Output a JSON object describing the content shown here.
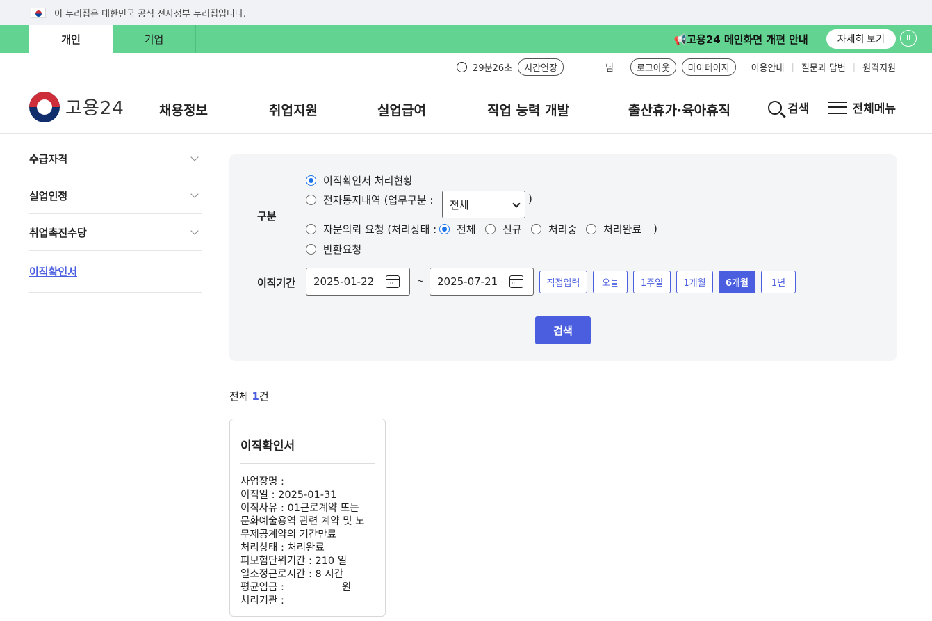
{
  "gov_banner": {
    "text": "이 누리집은 대한민국 공식 전자정부 누리집입니다."
  },
  "top_tabs": {
    "personal": "개인",
    "business": "기업"
  },
  "notice": {
    "text": "📢고용24 메인화면 개편 안내",
    "detail_button": "자세히 보기",
    "pause": "II"
  },
  "util": {
    "timer": "29분26초",
    "extend": "시간연장",
    "user_suffix": "님",
    "logout": "로그아웃",
    "mypage": "마이페이지",
    "links": [
      "이용안내",
      "질문과 답변",
      "원격지원"
    ]
  },
  "logo": {
    "text": "고용24"
  },
  "nav": {
    "items": [
      "채용정보",
      "취업지원",
      "실업급여",
      "직업 능력 개발",
      "출산휴가·육아휴직"
    ],
    "search": "검색",
    "all_menu": "전체메뉴"
  },
  "sidebar": {
    "items": [
      "수급자격",
      "실업인정",
      "취업촉진수당"
    ],
    "active": "이직확인서"
  },
  "form": {
    "category_label": "구분",
    "options": {
      "opt1": "이직확인서 처리현황",
      "opt2": "전자통지내역 (업무구분 :",
      "opt2_close": ")",
      "opt2_select": "전체",
      "opt3": "자문의뢰 요청 (처리상태 :",
      "opt3_sub": [
        "전체",
        "신규",
        "처리중",
        "처리완료"
      ],
      "opt3_close": ")",
      "opt4": "반환요청"
    },
    "period_label": "이직기간",
    "date_from": "2025-01-22",
    "tilde": "~",
    "date_to": "2025-07-21",
    "period_buttons": [
      "직접입력",
      "오늘",
      "1주일",
      "1개월",
      "6개월",
      "1년"
    ],
    "active_period": "6개월",
    "submit": "검색"
  },
  "results": {
    "total_prefix": "전체 ",
    "total_count": "1",
    "total_suffix": "건"
  },
  "card": {
    "title": "이직확인서",
    "lines": [
      "사업장명 :",
      "이직일 : 2025-01-31",
      "이직사유 : 01근로계약 또는",
      "문화예술용역 관련 계약 및 노",
      "무제공계약의 기간만료",
      "처리상태 : 처리완료",
      "피보험단위기간 : 210 일",
      "일소정근로시간 : 8 시간",
      "평균임금 :                  원",
      "처리기관 :"
    ]
  }
}
